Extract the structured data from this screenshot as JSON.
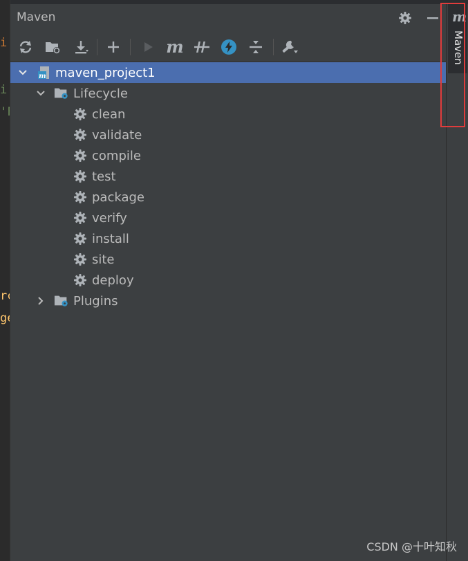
{
  "panel": {
    "title": "Maven"
  },
  "toolbar": {
    "buttons": [
      {
        "name": "reload-icon"
      },
      {
        "name": "folder-reload-icon"
      },
      {
        "name": "download-icon"
      },
      {
        "name": "add-icon"
      },
      {
        "name": "run-icon"
      },
      {
        "name": "maven-goal-icon"
      },
      {
        "name": "toggle-offline-icon"
      },
      {
        "name": "skip-tests-icon"
      },
      {
        "name": "collapse-all-icon"
      },
      {
        "name": "settings-wrench-icon"
      }
    ]
  },
  "tree": {
    "project": "maven_project1",
    "lifecycle": "Lifecycle",
    "goals": [
      "clean",
      "validate",
      "compile",
      "test",
      "package",
      "verify",
      "install",
      "site",
      "deploy"
    ],
    "plugins": "Plugins"
  },
  "editor_fragments": [
    "i",
    "'F",
    "rc",
    "ge"
  ],
  "right_tab": {
    "label": "Maven",
    "icon_letter": "m"
  },
  "watermark": "CSDN @十叶知秋",
  "colors": {
    "selection": "#4b6eaf",
    "background": "#3c3f41",
    "highlight": "#e03c3c",
    "accent": "#3592c4"
  }
}
